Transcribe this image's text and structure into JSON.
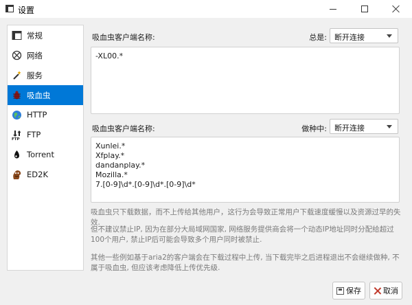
{
  "window": {
    "title": "设置"
  },
  "sidebar": {
    "items": [
      {
        "label": "常规",
        "icon": "general-icon"
      },
      {
        "label": "网络",
        "icon": "network-icon"
      },
      {
        "label": "服务",
        "icon": "magic-wand-icon"
      },
      {
        "label": "吸血虫",
        "icon": "bug-icon",
        "selected": true
      },
      {
        "label": "HTTP",
        "icon": "globe-icon"
      },
      {
        "label": "FTP",
        "icon": "ftp-icon"
      },
      {
        "label": "Torrent",
        "icon": "torrent-icon"
      },
      {
        "label": "ED2K",
        "icon": "ed2k-icon"
      }
    ]
  },
  "section1": {
    "label": "吸血虫客户端名称:",
    "combo_label": "总是:",
    "combo_value": "断开连接",
    "content": "-XL00.*"
  },
  "section2": {
    "label": "吸血虫客户端名称:",
    "combo_label": "做种中:",
    "combo_value": "断开连接",
    "content": "Xunlei.*\nXfplay.*\ndandanplay.*\nMozilla.*\n7.[0-9]\\d*.[0-9]\\d*.[0-9]\\d*"
  },
  "notes": [
    "吸血虫只下载数据，而不上传给其他用户，这行为会导致正常用户下载速度缓慢以及资源过早的失效.",
    "但不建议禁止IP, 因为在部分大局域网国家, 网络服务提供商会将一个动态IP地址同时分配给超过100个用户, 禁止IP后可能会导致多个用户同时被禁止.",
    "其他一些例如基于aria2的客户端会在下载过程中上传, 当下载完毕之后进程退出不会继续做种, 不属于吸血虫, 但应该考虑降低上传优先级."
  ],
  "buttons": {
    "save": "保存",
    "cancel": "取消"
  },
  "colors": {
    "accent": "#0078d7"
  }
}
